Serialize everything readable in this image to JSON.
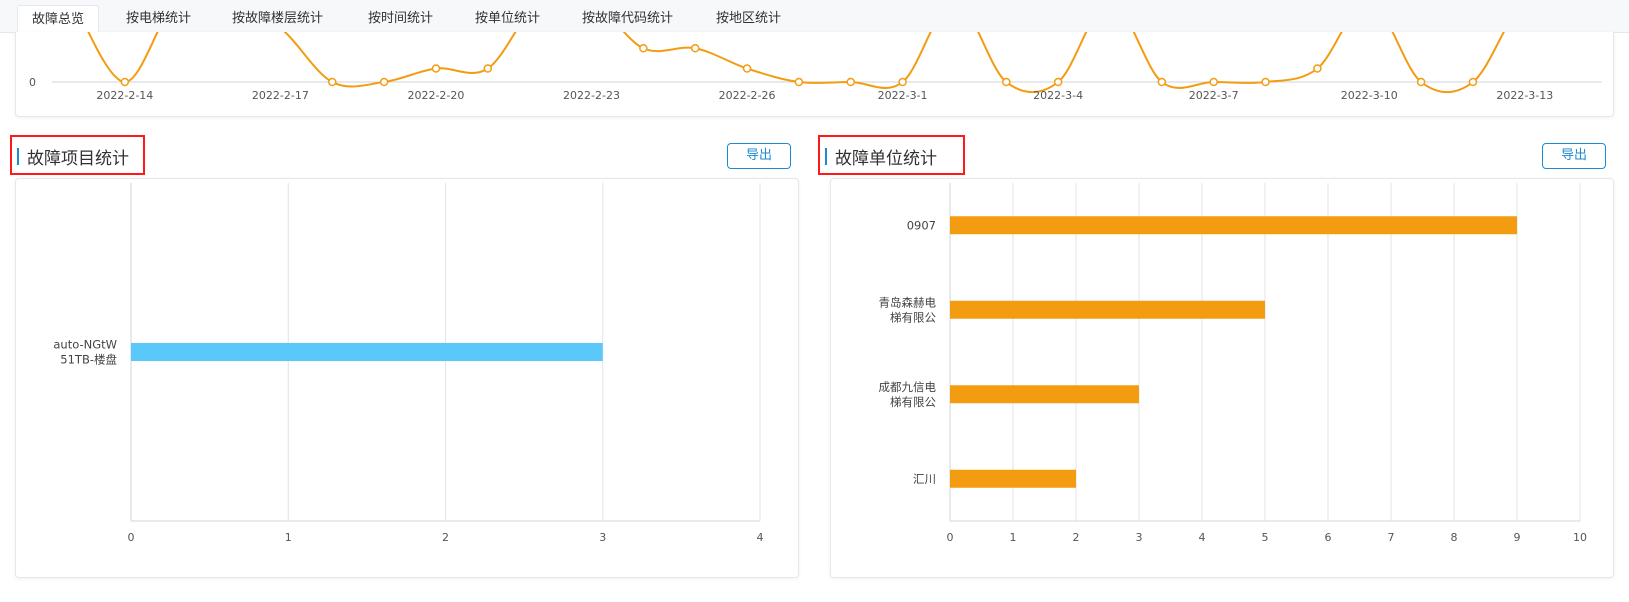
{
  "tabs": [
    {
      "label": "故障总览",
      "active": true
    },
    {
      "label": "按电梯统计"
    },
    {
      "label": "按故障楼层统计"
    },
    {
      "label": "按时间统计"
    },
    {
      "label": "按单位统计"
    },
    {
      "label": "按故障代码统计"
    },
    {
      "label": "按地区统计"
    }
  ],
  "sections": {
    "item": {
      "title": "故障项目统计",
      "export_label": "导出"
    },
    "unit": {
      "title": "故障单位统计",
      "export_label": "导出"
    }
  },
  "colors": {
    "accent": "#1b8bd6",
    "line": "#f39c12",
    "bar_blue": "#5bc8fa",
    "bar_orange": "#f39c12",
    "highlight_border": "#ff1a1a"
  },
  "chart_data": [
    {
      "type": "line",
      "ytick_visible": "0",
      "xtick_labels": [
        "2022-2-14",
        "2022-2-17",
        "2022-2-20",
        "2022-2-23",
        "2022-2-26",
        "2022-3-1",
        "2022-3-4",
        "2022-3-7",
        "2022-3-10",
        "2022-3-13"
      ],
      "x": [
        "2022-2-13",
        "2022-2-14",
        "2022-2-15",
        "2022-2-16",
        "2022-2-17",
        "2022-2-18",
        "2022-2-19",
        "2022-2-20",
        "2022-2-21",
        "2022-2-22",
        "2022-2-23",
        "2022-2-24",
        "2022-2-25",
        "2022-2-26",
        "2022-2-27",
        "2022-2-28",
        "2022-3-1",
        "2022-3-2",
        "2022-3-3",
        "2022-3-4",
        "2022-3-5",
        "2022-3-6",
        "2022-3-7",
        "2022-3-8",
        "2022-3-9",
        "2022-3-10",
        "2022-3-11",
        "2022-3-12",
        "2022-3-13",
        "2022-3-14",
        "2022-3-15"
      ],
      "values": [
        6,
        0,
        6,
        6,
        4,
        0,
        0,
        1,
        1,
        6,
        6,
        2.5,
        2.5,
        1,
        0,
        0,
        0,
        6,
        0,
        0,
        6,
        0,
        0,
        0,
        1,
        6,
        0,
        0,
        6,
        6,
        3.5
      ],
      "ylim": [
        0,
        6
      ],
      "note_cropped": "top of chart cut off"
    },
    {
      "type": "bar",
      "orientation": "horizontal",
      "categories": [
        "auto-NGtW51TB-楼盘"
      ],
      "category_lines": [
        [
          "auto-NGtW",
          "51TB-楼盘"
        ]
      ],
      "values": [
        3
      ],
      "xlim": [
        0,
        4
      ],
      "xticks": [
        "0",
        "1",
        "2",
        "3",
        "4"
      ]
    },
    {
      "type": "bar",
      "orientation": "horizontal",
      "categories": [
        "0907",
        "青岛森赫电梯有限公",
        "成都九信电梯有限公",
        "汇川"
      ],
      "category_lines": [
        [
          "0907"
        ],
        [
          "青岛森赫电",
          "梯有限公"
        ],
        [
          "成都九信电",
          "梯有限公"
        ],
        [
          "汇川"
        ]
      ],
      "values": [
        9,
        5,
        3,
        2
      ],
      "xlim": [
        0,
        10
      ],
      "xticks": [
        "0",
        "1",
        "2",
        "3",
        "4",
        "5",
        "6",
        "7",
        "8",
        "9",
        "10"
      ]
    }
  ]
}
